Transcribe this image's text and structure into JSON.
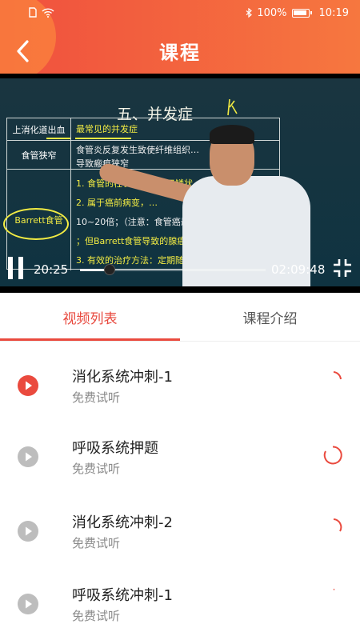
{
  "status_bar": {
    "battery": "100%",
    "time": "10:19"
  },
  "header": {
    "title": "课程"
  },
  "video": {
    "slide": {
      "title": "五、并发症",
      "rows": [
        {
          "left": "上消化道出血",
          "right": "最常见的并发症"
        },
        {
          "left": "食管狭窄",
          "right": "食管炎反复发生致使纤维组织…导致瘢痕狭窄"
        },
        {
          "left": "Barrett食管",
          "right_lines": [
            "1. 食管的柱状上皮取代了鳞状…化生",
            "2. 属于癌前病变，…",
            "10~20倍；（注意：食管癌最常见…",
            "；但Barrett食管导致的腺癌多）",
            "3. 有效的治疗方法：定期随访"
          ]
        }
      ]
    },
    "current_time": "20:25",
    "total_time": "02:09:48",
    "progress_fraction": 0.16
  },
  "tabs": [
    {
      "label": "视频列表",
      "active": true
    },
    {
      "label": "课程介绍",
      "active": false
    }
  ],
  "lessons": [
    {
      "title": "消化系统冲刺-1",
      "subtitle": "免费试听",
      "playing": true
    },
    {
      "title": "呼吸系统押题",
      "subtitle": "免费试听",
      "playing": false
    },
    {
      "title": "消化系统冲刺-2",
      "subtitle": "免费试听",
      "playing": false
    },
    {
      "title": "呼吸系统冲刺-1",
      "subtitle": "免费试听",
      "playing": false
    }
  ],
  "colors": {
    "accent": "#ea4a3e",
    "header_start": "#f0503e",
    "header_end": "#f6773f",
    "inactive_icon": "#bdbdbd"
  },
  "icons": {
    "back": "chevron-left-icon",
    "play": "play-icon",
    "pause": "pause-icon",
    "fullscreen_exit": "fullscreen-exit-icon",
    "loading": "loading-spinner-icon"
  }
}
